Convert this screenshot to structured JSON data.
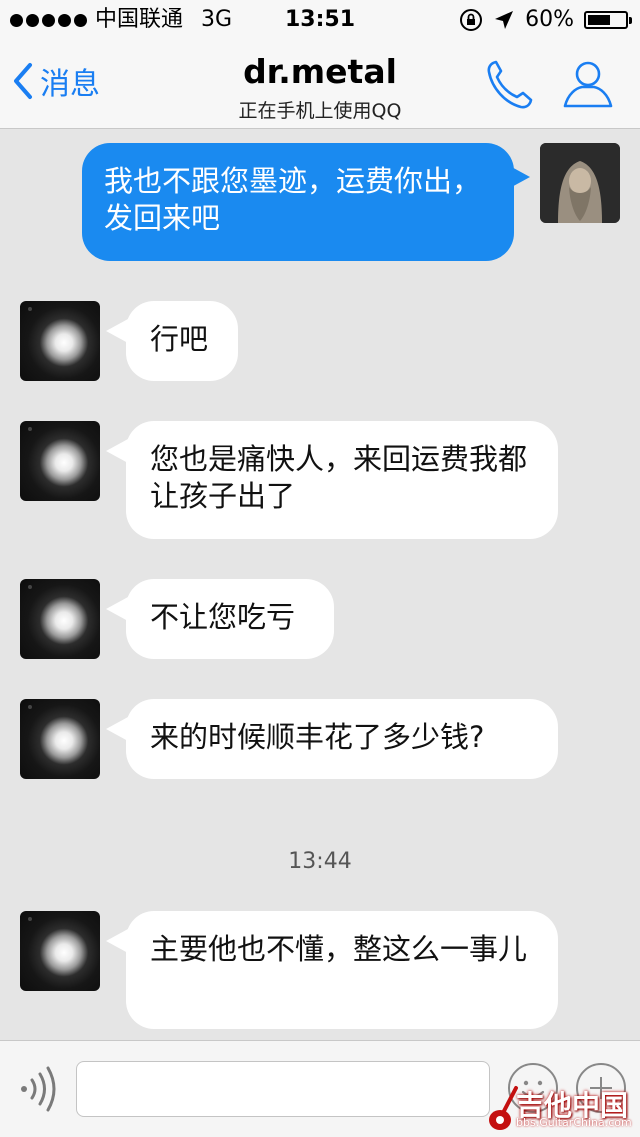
{
  "status_bar": {
    "carrier": "中国联通",
    "network": "3G",
    "time": "13:51",
    "battery_percent": "60%",
    "battery_level": 0.6
  },
  "nav": {
    "back_label": "消息",
    "title": "dr.metal",
    "subtitle": "正在手机上使用QQ"
  },
  "messages": [
    {
      "sender": "me",
      "text": "我也不跟您墨迹，运费你出，发回来吧"
    },
    {
      "sender": "other",
      "text": "行吧"
    },
    {
      "sender": "other",
      "text": "您也是痛快人，来回运费我都让孩子出了"
    },
    {
      "sender": "other",
      "text": "不让您吃亏"
    },
    {
      "sender": "other",
      "text": "来的时候顺丰花了多少钱?"
    },
    {
      "timestamp": "13:44"
    },
    {
      "sender": "other",
      "text": "主要他也不懂，整这么一事儿"
    }
  ],
  "input": {
    "value": "",
    "placeholder": ""
  },
  "watermark": {
    "title": "吉他中国",
    "url": "bbs.GuitarChina.com"
  },
  "colors": {
    "accent": "#1a7ef2",
    "outgoing_bubble": "#1a8af0",
    "incoming_bubble": "#ffffff",
    "chat_background": "#e5e5e5"
  }
}
